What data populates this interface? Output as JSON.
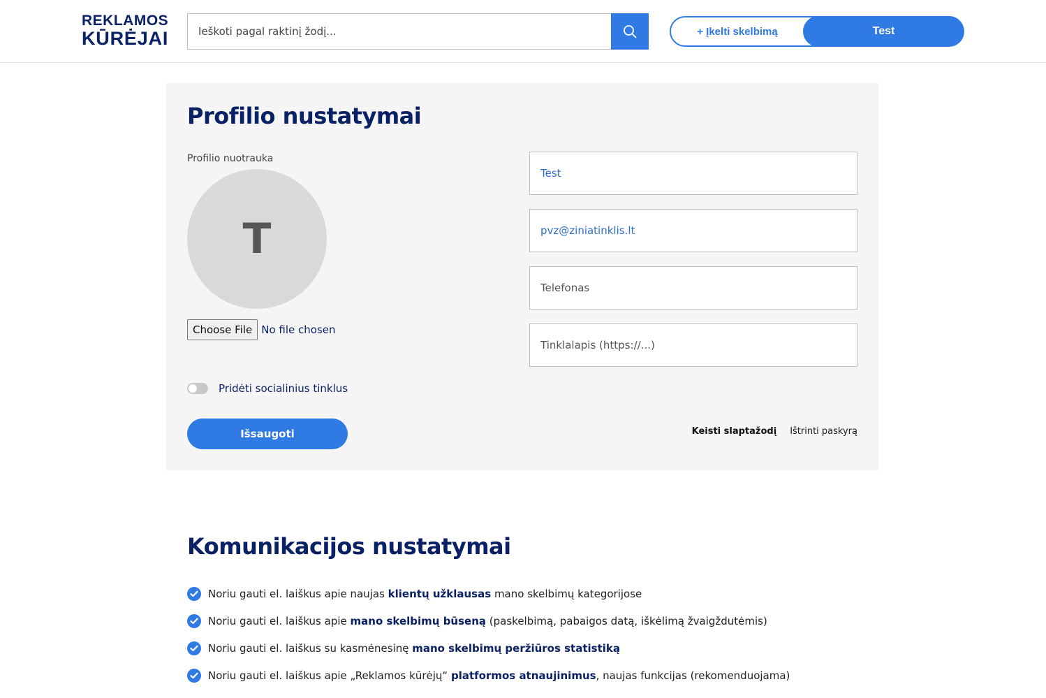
{
  "header": {
    "logo_line1": "REKLAMOS",
    "logo_line2": "KŪRĖJAI",
    "search_placeholder": "Ieškoti pagal raktinį žodį...",
    "upload_label": "+ Įkelti skelbimą",
    "user_label": "Test"
  },
  "profile": {
    "title": "Profilio nustatymai",
    "photo_label": "Profilio nuotrauka",
    "avatar_initial": "T",
    "file_button": "Choose File",
    "file_status": "No file chosen",
    "social_toggle_label": "Pridėti socialinius tinklus",
    "save_label": "Išsaugoti",
    "name_value": "Test",
    "email_value": "pvz@ziniatinklis.lt",
    "phone_placeholder": "Telefonas",
    "website_placeholder": "Tinklalapis (https://...)",
    "change_password": "Keisti slaptažodį",
    "delete_account": "Ištrinti paskyrą"
  },
  "communication": {
    "title": "Komunikacijos nustatymai",
    "items": [
      {
        "pre": "Noriu gauti el. laiškus apie naujas ",
        "bold": "klientų užklausas",
        "post": " mano skelbimų kategorijose"
      },
      {
        "pre": "Noriu gauti el. laiškus apie ",
        "bold": "mano skelbimų būseną",
        "post": " (paskelbimą, pabaigos datą, iškėlimą žvaigždutėmis)"
      },
      {
        "pre": "Noriu gauti el. laiškus su kasmėnesinę ",
        "bold": "mano skelbimų peržiūros statistiką",
        "post": ""
      },
      {
        "pre": "Noriu gauti el. laiškus apie „Reklamos kūrėjų“ ",
        "bold": "platformos atnaujinimus",
        "post": ", naujas funkcijas (rekomenduojama)"
      }
    ]
  },
  "colors": {
    "accent": "#2f7be3",
    "navy": "#0b2166",
    "card_bg": "#f5f5f5"
  }
}
